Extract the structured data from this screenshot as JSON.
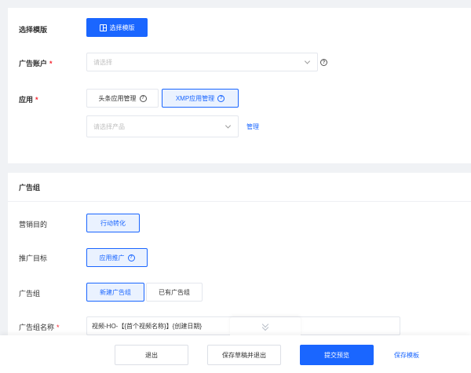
{
  "template": {
    "label": "选择模版",
    "button_label": "选择模版"
  },
  "ad_account": {
    "label": "广告账户",
    "required_mark": "*",
    "placeholder": "请选择"
  },
  "app": {
    "label": "应用",
    "required_mark": "*",
    "tabs": [
      {
        "label": "头条应用管理",
        "active": false
      },
      {
        "label": "XMP应用管理",
        "active": true
      }
    ],
    "product_placeholder": "请选择产品",
    "manage_link": "管理"
  },
  "ad_group_section": {
    "title": "广告组",
    "marketing_goal": {
      "label": "营销目的",
      "option": "行动转化"
    },
    "promotion_target": {
      "label": "推广目标",
      "option": "应用推广"
    },
    "ad_group": {
      "label": "广告组",
      "options": [
        {
          "label": "新建广告组",
          "active": true
        },
        {
          "label": "已有广告组",
          "active": false
        }
      ]
    },
    "ad_group_name": {
      "label": "广告组名称",
      "required_mark": "*",
      "value": "视频-HO-【{首个视频名称}】{创建日期}"
    }
  },
  "footer": {
    "exit": "退出",
    "save_draft_exit": "保存草稿并退出",
    "submit_preview": "提交预览",
    "save_template": "保存模板"
  },
  "colors": {
    "primary": "#1a66ff",
    "required": "#f5222d",
    "page_bg": "#f0f2f5"
  }
}
